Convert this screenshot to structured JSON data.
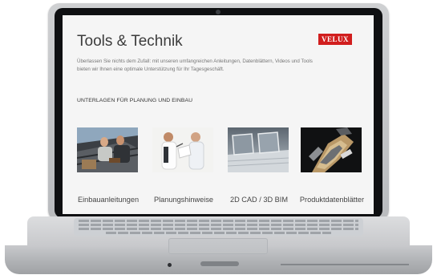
{
  "page": {
    "title": "Tools & Technik",
    "brand": "VELUX",
    "intro": "Überlassen Sie nichts dem Zufall: mit unseren umfangreichen Anleitungen, Datenblättern, Videos und Tools bieten wir Ihnen eine optimale Unterstützung für Ihr Tagesgeschäft.",
    "section_heading": "UNTERLAGEN FÜR PLANUNG UND EINBAU"
  },
  "cards": [
    {
      "label": "Einbauanleitungen",
      "image": "roof-installation-workers"
    },
    {
      "label": "Planungshinweise",
      "image": "two-men-planning"
    },
    {
      "label": "2D CAD / 3D BIM",
      "image": "roof-windows-render"
    },
    {
      "label": "Produktdatenblätter",
      "image": "window-cross-section"
    }
  ],
  "colors": {
    "brand_red": "#d11e1e",
    "screen_bg": "#f5f5f5"
  }
}
